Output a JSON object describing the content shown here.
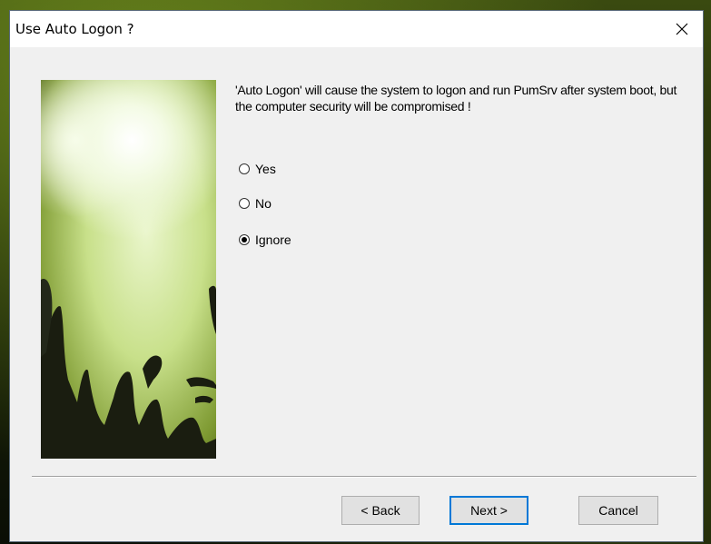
{
  "dialog": {
    "title": "Use Auto Logon ?",
    "message": "'Auto Logon' will cause the system to logon and run PumSrv after system boot, but the computer security will be compromised !"
  },
  "options": [
    {
      "label": "Yes",
      "checked": false
    },
    {
      "label": "No",
      "checked": false
    },
    {
      "label": "Ignore",
      "checked": true
    }
  ],
  "buttons": {
    "back": "< Back",
    "next": "Next >",
    "cancel": "Cancel"
  },
  "icons": {
    "close": "close-icon"
  }
}
